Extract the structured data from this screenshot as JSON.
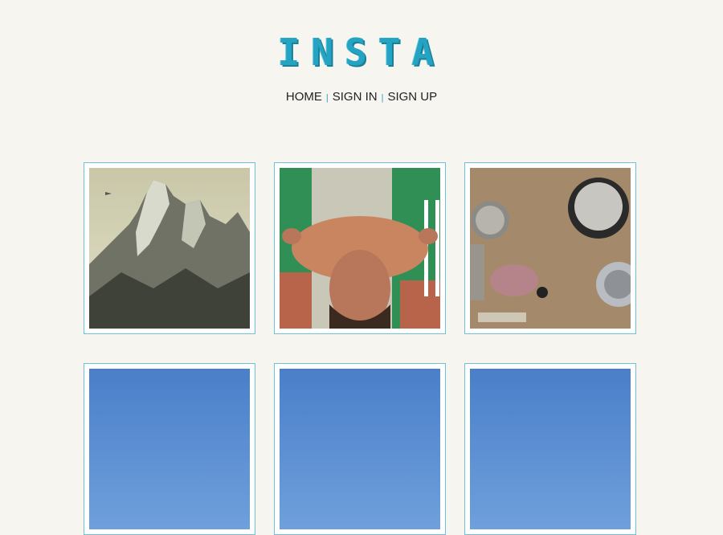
{
  "brand": {
    "logo": "INSTA"
  },
  "nav": {
    "home": "HOME",
    "sign_in": "SIGN IN",
    "sign_up": "SIGN UP",
    "separator": "|"
  },
  "photos": [
    {
      "subject": "mountain-photo"
    },
    {
      "subject": "man-poolside-photo"
    },
    {
      "subject": "cooking-pots-photo"
    },
    {
      "subject": "sky-photo"
    },
    {
      "subject": "sky-photo"
    },
    {
      "subject": "sky-photo"
    }
  ],
  "colors": {
    "accent": "#24a3c2",
    "background": "#f7f5f0",
    "card_border": "#6cc3d9"
  }
}
